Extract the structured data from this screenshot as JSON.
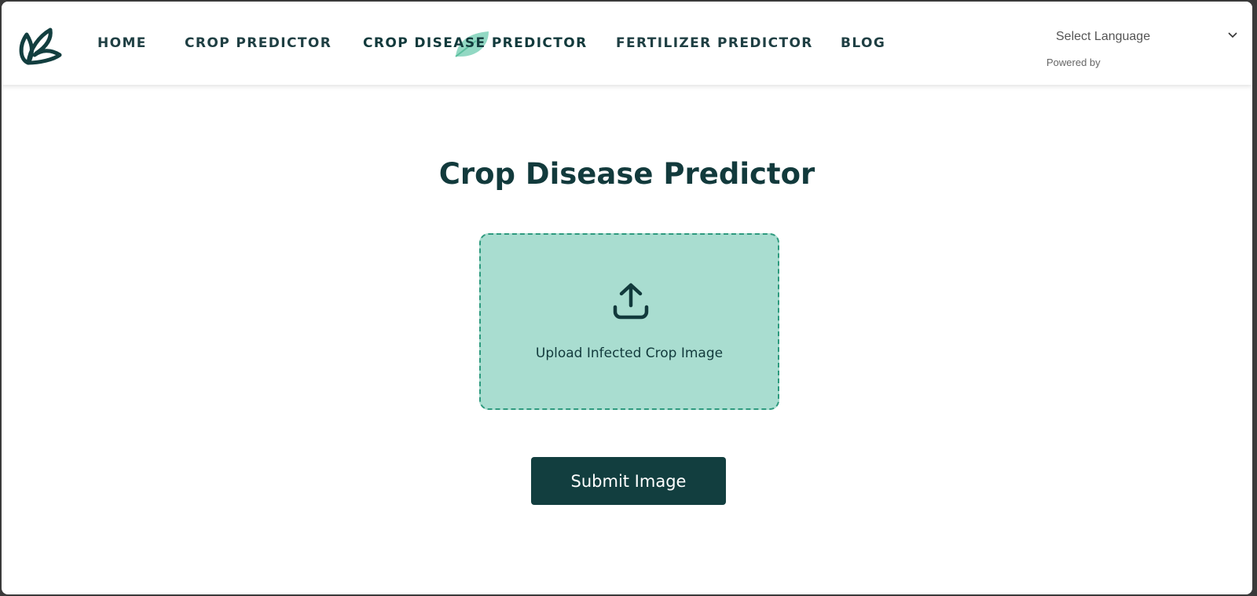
{
  "brand": {
    "logo_icon": "leaf-logo-icon"
  },
  "nav": {
    "items": [
      {
        "label": "HOME"
      },
      {
        "label": "CROP PREDICTOR"
      },
      {
        "label": "CROP DISEASE PREDICTOR",
        "active": true
      },
      {
        "label": "FERTILIZER PREDICTOR"
      },
      {
        "label": "BLOG"
      }
    ]
  },
  "language": {
    "select_label": "Select Language",
    "powered_by": "Powered by"
  },
  "main": {
    "title": "Crop Disease Predictor",
    "upload": {
      "icon": "upload-icon",
      "label": "Upload Infected Crop Image"
    },
    "submit_label": "Submit Image"
  },
  "colors": {
    "primary": "#123e3f",
    "upload_bg": "#a9ddd0",
    "upload_border": "#2e9a7e",
    "active_leaf": "#7fd1b8"
  }
}
